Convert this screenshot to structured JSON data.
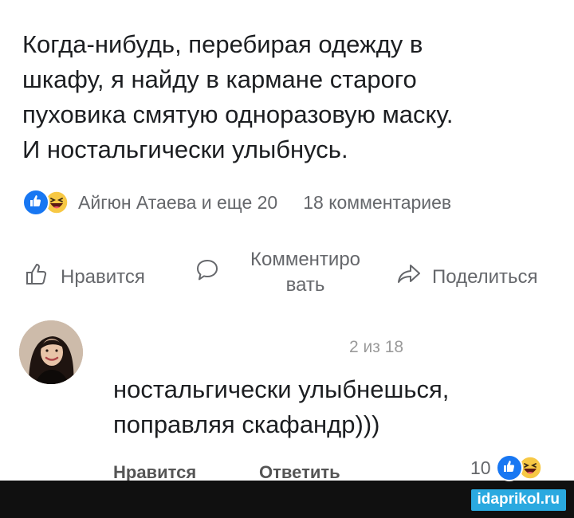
{
  "post": {
    "text_lines": [
      "Когда-нибудь, перебирая одежду в",
      "шкафу, я найду в кармане старого",
      "пуховика смятую одноразовую маску.",
      "И ностальгически улыбнусь."
    ],
    "reactions": {
      "icons": [
        "like-reaction-icon",
        "haha-reaction-icon"
      ],
      "reactors_text": "Айгюн Атаева и еще 20",
      "comments_count_text": "18 комментариев"
    },
    "actions": {
      "like": "Нравится",
      "comment": "Комментиро вать",
      "share": "Поделиться"
    }
  },
  "comment": {
    "position_text": "2 из 18",
    "text_lines": [
      "ностальгически улыбнешься,",
      "поправляя скафандр)))"
    ],
    "actions": {
      "like": "Нравится",
      "reply": "Ответить"
    },
    "reaction_count": "10"
  },
  "footer": {
    "watermark": "idaprikol.ru"
  },
  "colors": {
    "text": "#1c1e21",
    "secondary": "#65676b",
    "like_blue": "#1877f2",
    "haha_yellow": "#f7c844",
    "footer_bg": "#101010",
    "watermark_bg": "#2aa9e0"
  }
}
